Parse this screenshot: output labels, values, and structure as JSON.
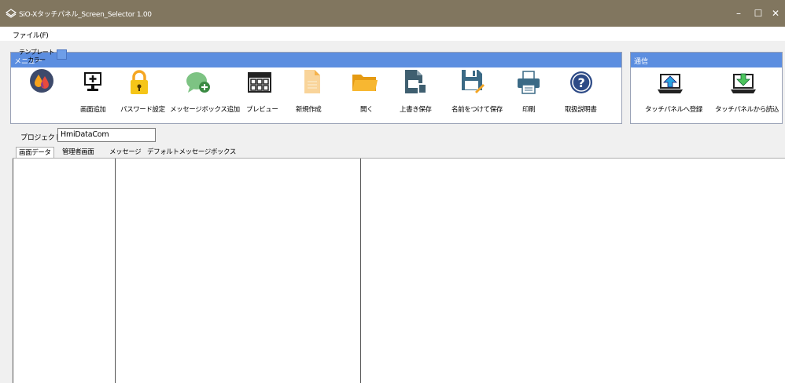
{
  "window": {
    "title": "SiO-Xタッチパネル_Screen_Selector 1.00",
    "title_color": "#81765f",
    "minimize": "–",
    "maximize": "☐",
    "close": "✕"
  },
  "menubar": {
    "file": "ファイル(F)"
  },
  "menu_panel": {
    "header": "メニュー",
    "header_color": "#5c8ee0",
    "template": {
      "label": "テンプレート\nカラー",
      "swatch_color": "#6e9ee8"
    },
    "tools": [
      {
        "id": "add-screen",
        "label": "画面追加",
        "icon": "monitor-plus-icon"
      },
      {
        "id": "password",
        "label": "パスワード設定",
        "icon": "lock-icon"
      },
      {
        "id": "add-msgbox",
        "label": "メッセージボックス追加",
        "icon": "chat-plus-icon"
      },
      {
        "id": "preview",
        "label": "プレビュー",
        "icon": "grid-preview-icon"
      },
      {
        "id": "new",
        "label": "新規作成",
        "icon": "new-document-icon"
      },
      {
        "id": "open",
        "label": "開く",
        "icon": "folder-icon"
      },
      {
        "id": "overwrite-save",
        "label": "上書き保存",
        "icon": "save-file-icon"
      },
      {
        "id": "save-as",
        "label": "名前をつけて保存",
        "icon": "save-as-icon"
      },
      {
        "id": "print",
        "label": "印刷",
        "icon": "printer-icon"
      },
      {
        "id": "manual",
        "label": "取扱説明書",
        "icon": "help-icon"
      }
    ]
  },
  "comm_panel": {
    "header": "通信",
    "tools": [
      {
        "id": "register",
        "label": "タッチパネルへ登録",
        "icon": "upload-laptop-icon"
      },
      {
        "id": "read",
        "label": "タッチパネルから読込",
        "icon": "download-laptop-icon"
      }
    ]
  },
  "project": {
    "label": "プロジェクト名",
    "value": "HmiDataCom"
  },
  "tabs": [
    {
      "label": "画面データ",
      "active": true
    },
    {
      "label": "管理者画面",
      "active": false
    },
    {
      "label": "メッセージ",
      "active": false
    },
    {
      "label": "デフォルトメッセージボックス",
      "active": false
    }
  ]
}
